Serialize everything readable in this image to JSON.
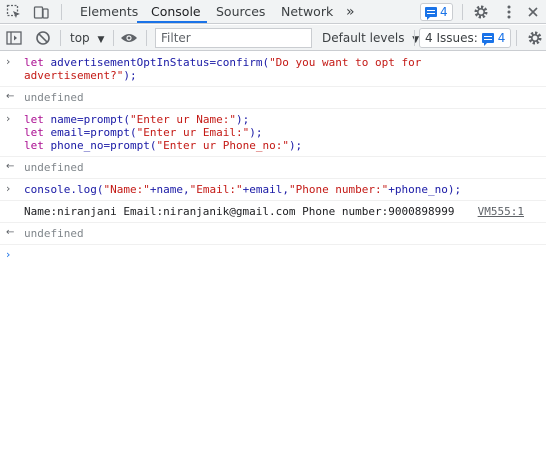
{
  "tabs": {
    "elements": "Elements",
    "console": "Console",
    "sources": "Sources",
    "network": "Network",
    "more": "»",
    "messages_count": "4"
  },
  "toolbar": {
    "context": "top",
    "filter_placeholder": "Filter",
    "levels": "Default levels",
    "issues_label": "4 Issues:",
    "issues_count": "4"
  },
  "console": {
    "entries": [
      {
        "type": "input",
        "code": "let advertisementOptInStatus=confirm(\"Do you want to opt for advertisement?\");"
      },
      {
        "type": "result",
        "text": "undefined"
      },
      {
        "type": "input",
        "code": "let name=prompt(\"Enter ur Name:\");\nlet email=prompt(\"Enter ur Email:\");\nlet phone_no=prompt(\"Enter ur Phone_no:\");"
      },
      {
        "type": "result",
        "text": "undefined"
      },
      {
        "type": "input",
        "code": "console.log(\"Name:\"+name,\"Email:\"+email,\"Phone number:\"+phone_no);"
      },
      {
        "type": "log",
        "text": "Name:niranjani Email:niranjanik@gmail.com Phone number:9000898999",
        "source": "VM555:1"
      },
      {
        "type": "result",
        "text": "undefined"
      }
    ]
  },
  "colors": {
    "accent": "#1a73e8",
    "keyword": "#aa0d91",
    "string": "#c41a16",
    "identifier": "#1a1aa6"
  }
}
